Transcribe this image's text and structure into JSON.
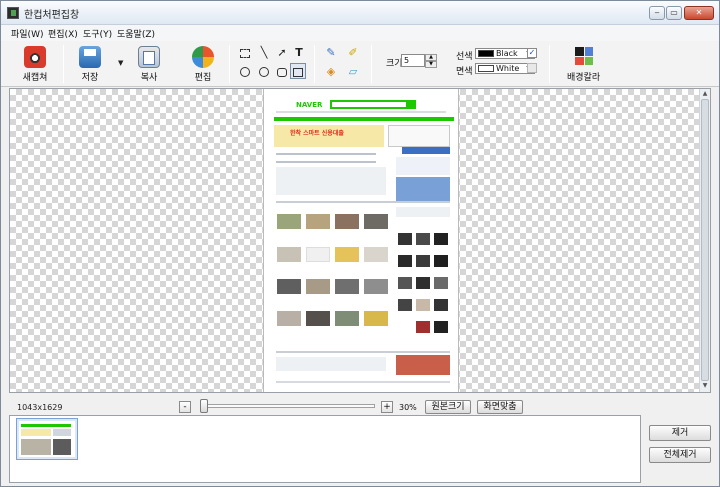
{
  "window": {
    "title": "한컵처편집창",
    "min_icon": "minimize-icon",
    "max_icon": "maximize-icon",
    "close_icon": "close-icon"
  },
  "menu": [
    {
      "label": "파일(W)"
    },
    {
      "label": "편집(X)"
    },
    {
      "label": "도구(Y)"
    },
    {
      "label": "도움말(Z)"
    }
  ],
  "toolbar": {
    "new_capture": "새캡쳐",
    "save": "저장",
    "copy": "복사",
    "edit": "편집",
    "size_label": "크기",
    "size_value": "5",
    "line_label": "선색",
    "line_color_name": "Black",
    "line_color": "#000000",
    "line_checked": true,
    "fill_label": "면색",
    "fill_color_name": "White",
    "fill_color": "#ffffff",
    "fill_checked": false,
    "bg_color": "배경칼라",
    "tools": {
      "select_rect": "select-rect-icon",
      "line": "line-icon",
      "arrow": "arrow-icon",
      "text": "T",
      "circle_dashed": "ellipse-select-icon",
      "circle": "ellipse-icon",
      "rounded_rect": "rounded-rect-icon",
      "rect": "rect-icon",
      "pen": "pen-icon",
      "highlighter": "highlighter-icon",
      "fill": "paint-bucket-icon",
      "eraser": "eraser-icon"
    }
  },
  "captured_page": {
    "logo": "NAVER",
    "banner": "한착 스마트 신용대출",
    "accent": "#1ec800"
  },
  "status": {
    "dimensions": "1043x1629",
    "zoom_minus": "-",
    "zoom_plus": "+",
    "zoom_percent": "30%",
    "zoom_level": 0.3,
    "original_size": "원본크기",
    "fit_screen": "화면맞춤"
  },
  "side_buttons": {
    "remove": "제거",
    "remove_all": "전체제거"
  },
  "scroll": {
    "up": "▲",
    "down": "▼"
  }
}
